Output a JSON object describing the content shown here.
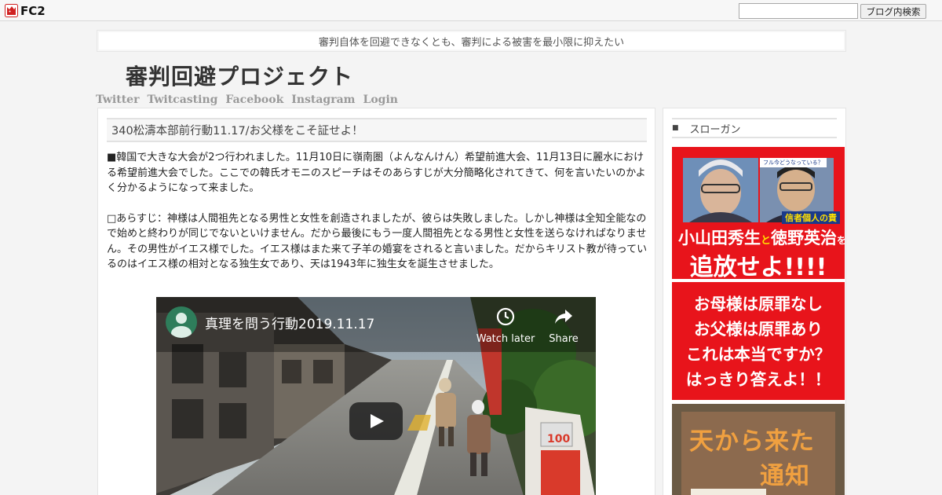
{
  "topbar": {
    "logo_text": "FC2",
    "search_placeholder": "",
    "search_button": "ブログ内検索"
  },
  "blog": {
    "tagline": "審判自体を回避できなくとも、審判による被害を最小限に抑えたい",
    "title": "審判回避プロジェクト",
    "nav": [
      "Twitter",
      "Twitcasting",
      "Facebook",
      "Instagram",
      "Login"
    ]
  },
  "entry": {
    "title": "340松濤本部前行動11.17/お父様をこそ証せよ！",
    "paragraphs": [
      "■韓国で大きな大会が2つ行われました。11月10日に嶺南圏（よんなんけん）希望前進大会、11月13日に麗水における希望前進大会でした。ここでの韓氏オモニのスピーチはそのあらすじが大分簡略化されてきて、何を言いたいのかよく分かるようになって来ました。",
      "□あらすじ：神様は人間祖先となる男性と女性を創造されましたが、彼らは失敗しました。しかし神様は全知全能なので始めと終わりが同じでないといけません。だから最後にもう一度人間祖先となる男性と女性を送らなければなりません。その男性がイエス様でした。イエス様はまた来て子羊の婚宴をされると言いました。だからキリスト教が待っているのはイエス様の相対となる独生女であり、天は1943年に独生女を誕生させました。"
    ],
    "video": {
      "title": "真理を問う行動2019.11.17",
      "watch_later": "Watch later",
      "share": "Share",
      "sign_text": "100"
    }
  },
  "sidebar": {
    "heading_bullet": "■",
    "heading": "スローガン",
    "banner1": {
      "line1": "小山田秀生",
      "connector": "と",
      "line2": "徳野英治",
      "suffix": "を",
      "line3": "追放せよ!!!!",
      "caption": "信者個人の責",
      "tag": "フル今どうなっている？"
    },
    "banner2": {
      "lines": [
        "お母様は原罪なし",
        "お父様は原罪あり",
        "これは本当ですか？",
        "はっきり答えよ！！"
      ]
    },
    "banner3": {
      "line1": "天から来た",
      "line2": "通知"
    }
  },
  "colors": {
    "banner_red": "#e8141b",
    "link_gray": "#999999",
    "page_bg": "#f4f4f4"
  }
}
